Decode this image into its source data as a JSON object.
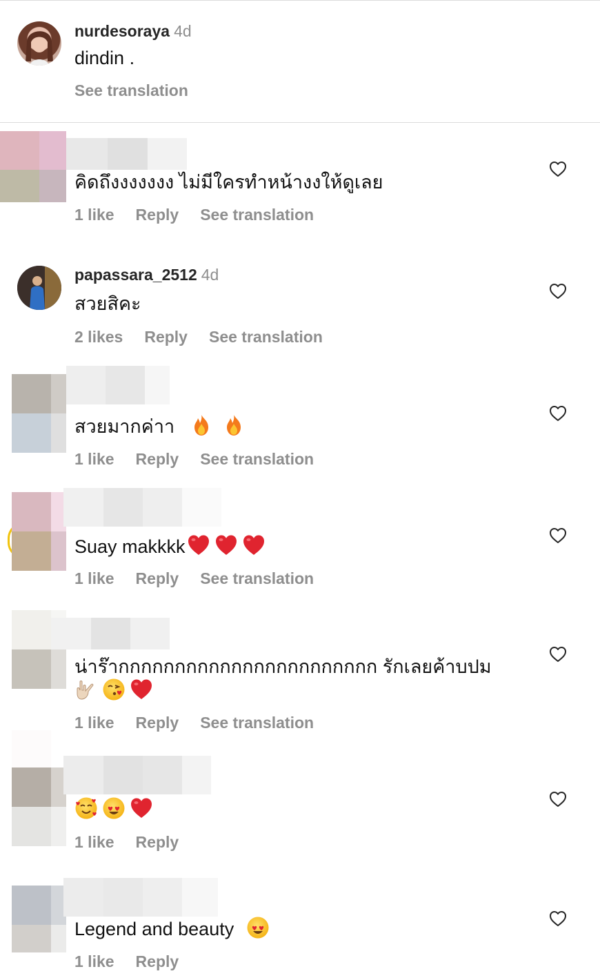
{
  "caption": {
    "username": "nurdesoraya",
    "time": "4d",
    "text": "dindin .",
    "see_translation": "See translation"
  },
  "comments": [
    {
      "username": "",
      "time": "",
      "text": "คิดถึงงงงงงง ไม่มีใครทำหน้างงให้ดูเลย",
      "emoji": [],
      "likes": "1 like",
      "reply": "Reply",
      "see_translation": "See translation"
    },
    {
      "username": "papassara_2512",
      "time": "4d",
      "text": "สวยสิคะ",
      "emoji": [],
      "likes": "2 likes",
      "reply": "Reply",
      "see_translation": "See translation"
    },
    {
      "username": "",
      "time": "",
      "text": "สวยมากค่าา",
      "emoji": [
        "fire-emoji",
        "fire-emoji"
      ],
      "likes": "1 like",
      "reply": "Reply",
      "see_translation": "See translation"
    },
    {
      "username": "",
      "time": "",
      "text": "Suay makkkk",
      "emoji": [
        "heart-emoji",
        "heart-emoji",
        "heart-emoji"
      ],
      "likes": "1 like",
      "reply": "Reply",
      "see_translation": "See translation"
    },
    {
      "username": "",
      "time": "",
      "text": "น่าร๊ากกกกกกกกกกกกกกกกกกกกกกก รักเลยค้าบปม",
      "emoji": [
        "love-you-gesture-emoji",
        "kissing-face-emoji",
        "heart-emoji"
      ],
      "likes": "1 like",
      "reply": "Reply",
      "see_translation": "See translation"
    },
    {
      "username": "",
      "time": "",
      "text": "",
      "emoji": [
        "smiling-face-with-hearts-emoji",
        "heart-eyes-emoji",
        "heart-emoji"
      ],
      "likes": "1 like",
      "reply": "Reply",
      "see_translation": ""
    },
    {
      "username": "",
      "time": "",
      "text": "Legend and beauty",
      "emoji": [
        "heart-eyes-emoji"
      ],
      "likes": "1 like",
      "reply": "Reply",
      "see_translation": ""
    }
  ],
  "icons": {
    "like": "heart-outline-icon"
  },
  "colors": {
    "muted_text": "#8e8e8e",
    "divider": "#dbdbdb",
    "heart_emoji": "#e0242f",
    "fire_emoji": "#f47a1c"
  }
}
